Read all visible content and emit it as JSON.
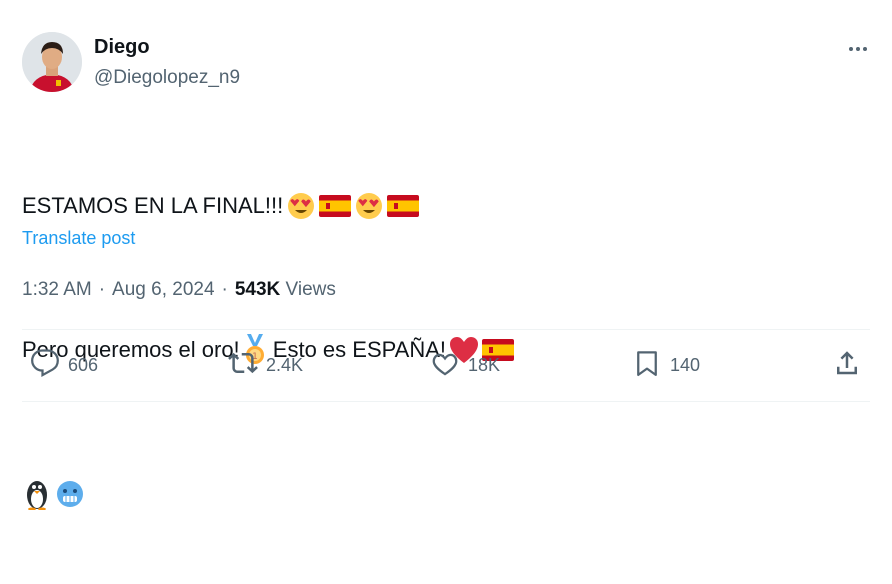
{
  "author": {
    "name": "Diego",
    "handle": "@Diegolopez_n9"
  },
  "tweet": {
    "line1": "ESTAMOS EN LA FINAL!!!",
    "line2a": "Pero queremos el oro!",
    "line2b": " Esto es ESPAÑA!",
    "emoji_line1": [
      "heart-eyes-emoji",
      "spain-flag-emoji",
      "heart-eyes-emoji",
      "spain-flag-emoji"
    ],
    "emoji_line2": [
      "gold-medal-emoji",
      "red-heart-emoji",
      "spain-flag-emoji"
    ],
    "emoji_line3": [
      "penguin-emoji",
      "cold-face-emoji"
    ]
  },
  "translate_label": "Translate post",
  "meta": {
    "time": "1:32 AM",
    "separator": "·",
    "date": "Aug 6, 2024",
    "views_count": "543K",
    "views_label": " Views"
  },
  "actions": {
    "replies": "606",
    "reposts": "2.4K",
    "likes": "18K",
    "bookmarks": "140"
  },
  "colors": {
    "link": "#1d9bf0",
    "secondary": "#536471",
    "primary": "#0f1419"
  }
}
